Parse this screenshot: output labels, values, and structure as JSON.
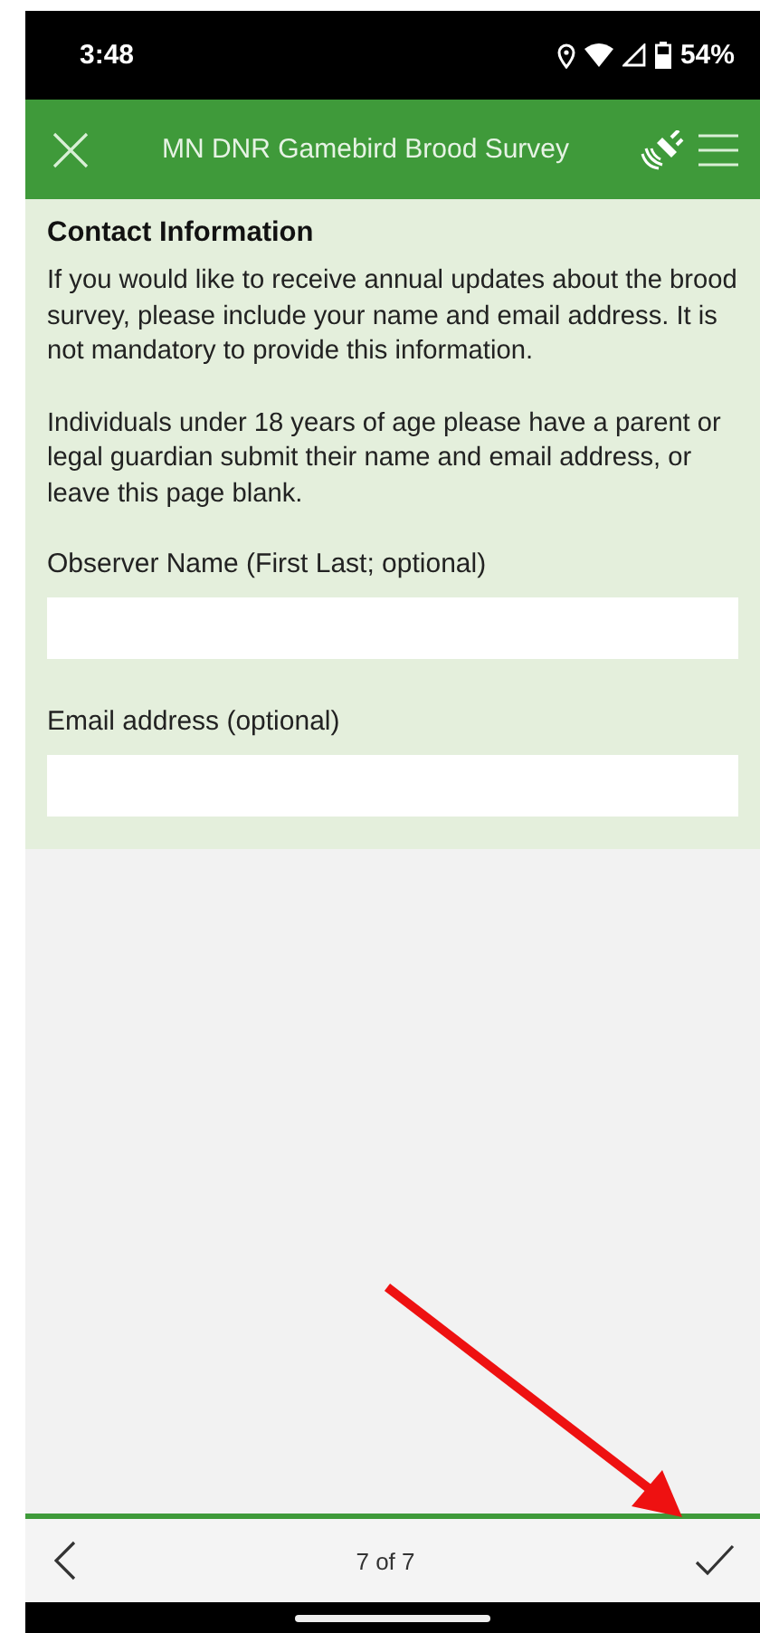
{
  "status_bar": {
    "time": "3:48",
    "battery": "54%"
  },
  "header": {
    "title": "MN DNR Gamebird Brood Survey"
  },
  "section": {
    "title": "Contact Information",
    "paragraphs": [
      "If you would like to receive annual updates about the brood survey, please include your name and email address. It is not mandatory to provide this information.",
      "Individuals under 18 years of age please have a parent or legal guardian submit their name and email address, or leave this page blank."
    ],
    "fields": [
      {
        "label": "Observer Name (First Last; optional)"
      },
      {
        "label": "Email address (optional)"
      }
    ]
  },
  "progress": {
    "level": 1
  },
  "footer": {
    "page": "7 of 7"
  }
}
